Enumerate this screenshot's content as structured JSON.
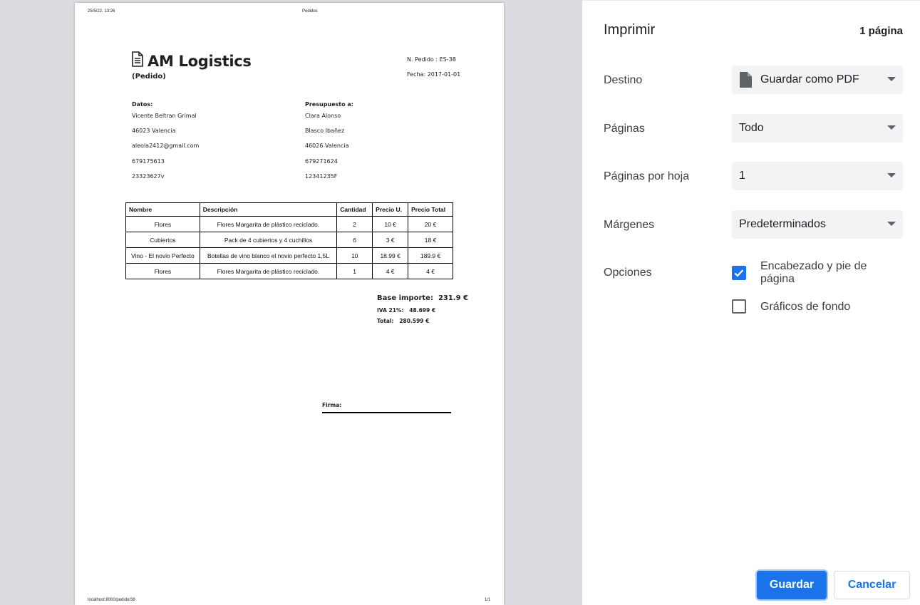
{
  "preview": {
    "header_left": "25/5/22, 13:26",
    "header_center": "Pedidos",
    "footer_left": "localhost:8000/pedido/38",
    "footer_right": "1/1",
    "company": "AM Logistics",
    "doc_type": "(Pedido)",
    "order_number": "N. Pedido : ES-38",
    "order_date": "Fecha: 2017-01-01",
    "datos": {
      "heading": "Datos:",
      "lines": [
        "Vicente Beltran Grimal",
        "46023 Valencia",
        "aleola2412@gmail.com",
        "679175613",
        "23323627v"
      ]
    },
    "presupuesto": {
      "heading": "Presupuesto a:",
      "lines": [
        "Clara Alonso",
        "Blasco Ibañez",
        "46026 Valencia",
        "679271624",
        "12341235F"
      ]
    },
    "table": {
      "headers": [
        "Nombre",
        "Descripción",
        "Cantidad",
        "Precio U.",
        "Precio Total"
      ],
      "rows": [
        [
          "Flores",
          "Flores Margarita de plástico reciclado.",
          "2",
          "10 €",
          "20 €"
        ],
        [
          "Cubiertos",
          "Pack de 4 cubiertos y 4 cuchillos",
          "6",
          "3 €",
          "18 €"
        ],
        [
          "Vino - El novio Perfecto",
          "Botellas de vino blanco el novio perfecto 1,5L",
          "10",
          "18.99 €",
          "189.9 €"
        ],
        [
          "Flores",
          "Flores Margarita de plástico reciclado.",
          "1",
          "4 €",
          "4 €"
        ]
      ]
    },
    "totals": {
      "base_label": "Base importe:",
      "base_value": "231.9 €",
      "iva_label": "IVA 21%:",
      "iva_value": "48.699 €",
      "total_label": "Total:",
      "total_value": "280.599 €"
    },
    "firma": "Firma:"
  },
  "panel": {
    "title": "Imprimir",
    "page_count": "1 página",
    "destino_label": "Destino",
    "destino_value": "Guardar como PDF",
    "paginas_label": "Páginas",
    "paginas_value": "Todo",
    "por_hoja_label": "Páginas por hoja",
    "por_hoja_value": "1",
    "margenes_label": "Márgenes",
    "margenes_value": "Predeterminados",
    "opciones_label": "Opciones",
    "opt_headers": "Encabezado y pie de página",
    "opt_headers_checked": true,
    "opt_background": "Gráficos de fondo",
    "opt_background_checked": false,
    "save_label": "Guardar",
    "cancel_label": "Cancelar"
  },
  "colors": {
    "accent": "#1a73e8",
    "select_bg": "#f1f3f4",
    "preview_bg": "#dadce0"
  }
}
